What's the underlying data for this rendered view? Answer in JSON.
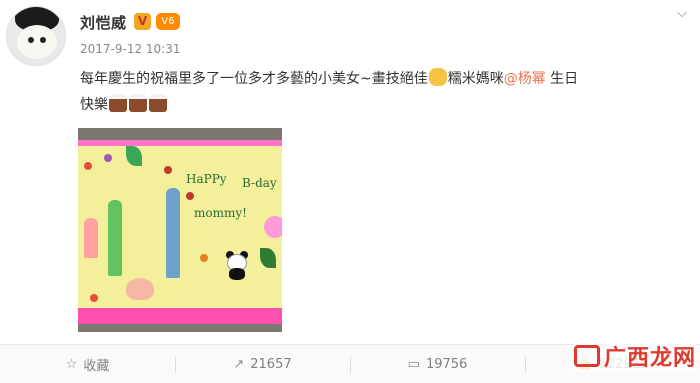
{
  "user": {
    "name": "刘恺威",
    "verified_badge": "V",
    "vip_badge": "V6",
    "timestamp": "2017-9-12 10:31",
    "avatar": "avatar-icon"
  },
  "menu": {
    "icon": "chevron-down-icon",
    "glyph": "⌵"
  },
  "post": {
    "text_part1": "每年慶生的祝福里多了一位多才多藝的小美女~畫技絕佳",
    "text_part2": "糯米媽咪",
    "mention": "@杨幂",
    "text_part3": " 生日",
    "text_part4": "快樂",
    "emoji_hand": "clap-emoji",
    "emoji_cake": "cake-emoji",
    "mention_color": "#eb7350"
  },
  "photo": {
    "drawing_text_1": "HaPPy",
    "drawing_text_2": "B-day",
    "drawing_text_3": "mommy!"
  },
  "actions": [
    {
      "icon": "star-icon",
      "glyph": "☆",
      "label": "收藏"
    },
    {
      "icon": "share-icon",
      "glyph": "↗",
      "label": "21657"
    },
    {
      "icon": "comment-icon",
      "glyph": "▭",
      "label": "19756"
    },
    {
      "icon": "like-icon",
      "glyph": "👍",
      "label": "522925"
    }
  ],
  "watermark": {
    "text": "广西龙网"
  }
}
